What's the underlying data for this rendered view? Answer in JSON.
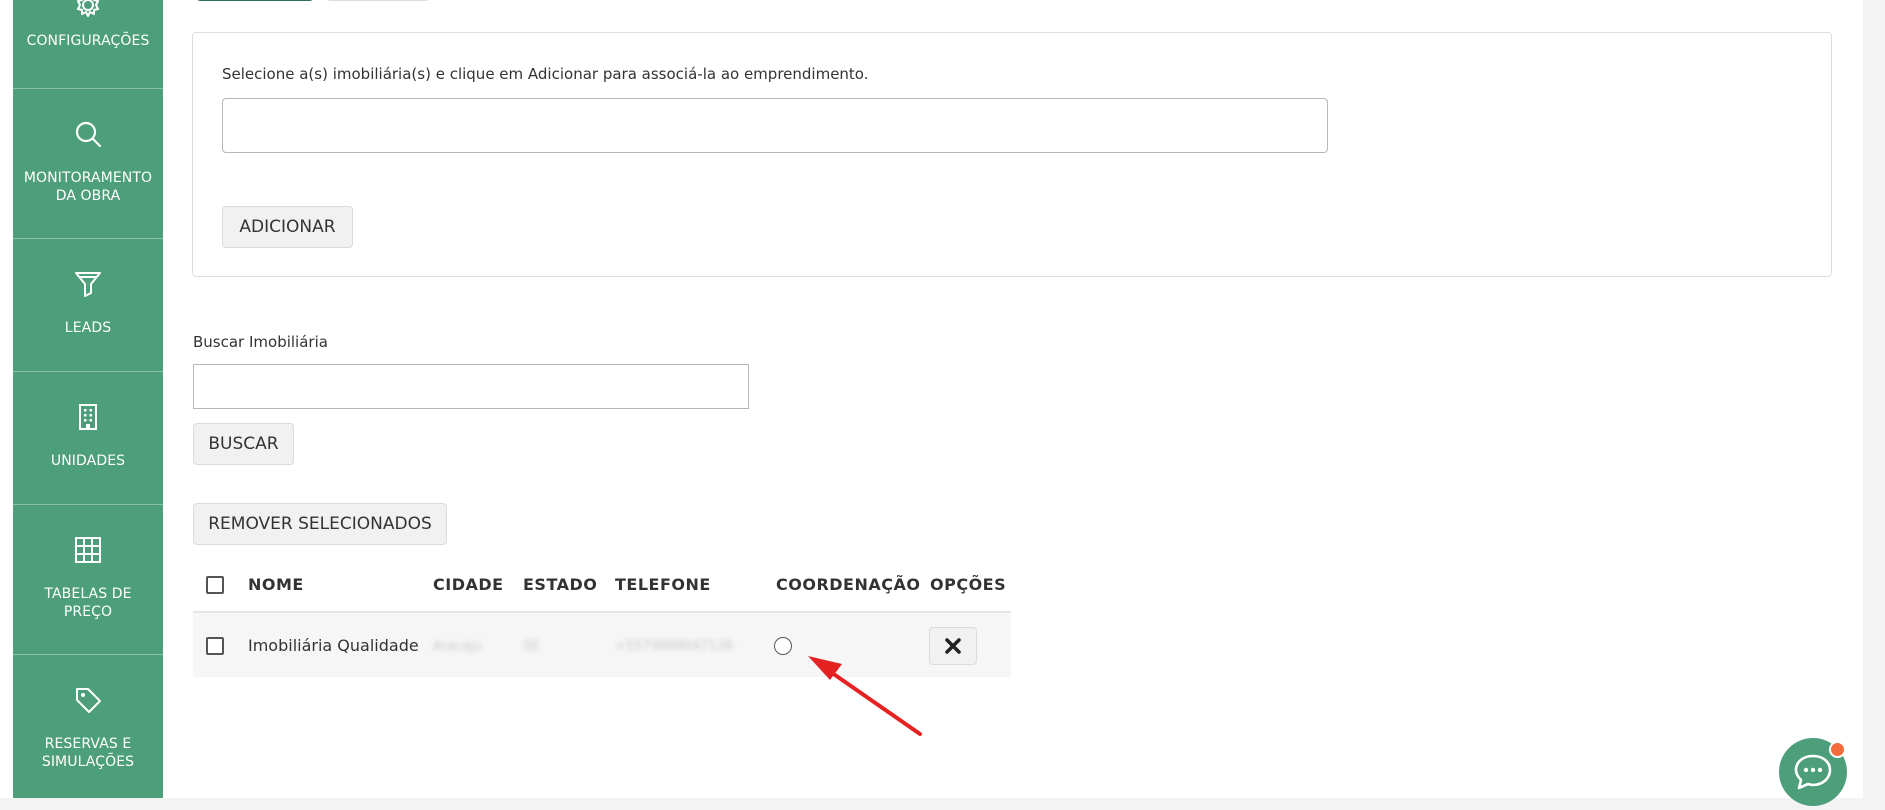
{
  "sidebar": {
    "items": [
      {
        "label": "CONFIGURAÇÕES",
        "icon": "gear-icon"
      },
      {
        "label": "MONITORAMENTO DA OBRA",
        "icon": "search-icon"
      },
      {
        "label": "LEADS",
        "icon": "funnel-icon"
      },
      {
        "label": "UNIDADES",
        "icon": "building-icon"
      },
      {
        "label": "TABELAS DE PREÇO",
        "icon": "grid-icon"
      },
      {
        "label": "RESERVAS E SIMULAÇÕES",
        "icon": "tag-icon"
      }
    ],
    "color": "#4d9e7a"
  },
  "add_panel": {
    "instruction": "Selecione a(s) imobiliária(s) e clique em Adicionar para associá-la ao emprendimento.",
    "input_value": "",
    "add_button": "ADICIONAR"
  },
  "search": {
    "label": "Buscar Imobiliária",
    "input_value": "",
    "button": "BUSCAR"
  },
  "remove_button": "REMOVER SELECIONADOS",
  "table": {
    "columns": [
      "NOME",
      "CIDADE",
      "ESTADO",
      "TELEFONE",
      "COORDENAÇÃO",
      "OPÇÕES"
    ],
    "rows": [
      {
        "nome": "Imobiliária Qualidade",
        "cidade": "Aracaju",
        "estado": "SE",
        "telefone": "+5579998047126",
        "coordenacao_selected": false
      }
    ]
  },
  "annotation": {
    "arrow_color": "#e52222"
  },
  "chat": {
    "icon": "chat-bubble-icon",
    "badge_color": "#f26b3a"
  }
}
